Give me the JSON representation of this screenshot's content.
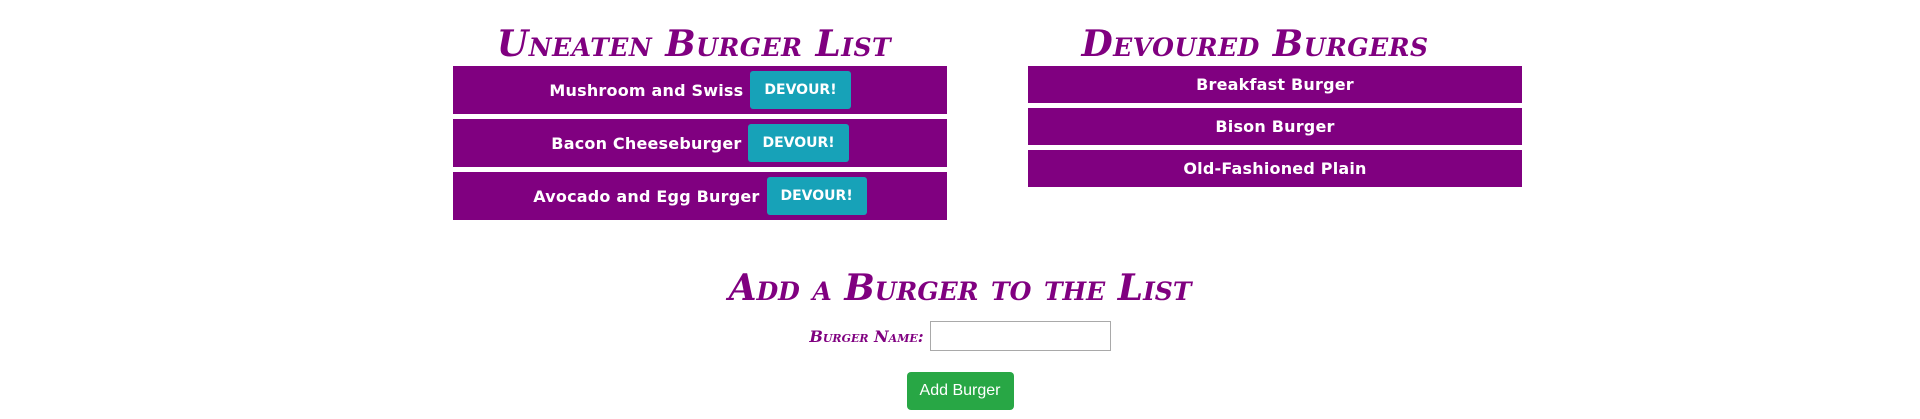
{
  "uneaten": {
    "title": "Uneaten Burger List",
    "button_label": "DEVOUR!",
    "items": [
      {
        "name": "Mushroom and Swiss"
      },
      {
        "name": "Bacon Cheeseburger"
      },
      {
        "name": "Avocado and Egg Burger"
      }
    ]
  },
  "devoured": {
    "title": "Devoured Burgers",
    "items": [
      {
        "name": "Breakfast Burger"
      },
      {
        "name": "Bison Burger"
      },
      {
        "name": "Old-Fashioned Plain"
      }
    ]
  },
  "add_form": {
    "title": "Add a Burger to the List",
    "field_label": "Burger Name:",
    "input_value": "",
    "submit_label": "Add Burger"
  },
  "colors": {
    "brand_purple": "#800080",
    "devour_button": "#17a2b8",
    "add_button": "#28a745"
  }
}
